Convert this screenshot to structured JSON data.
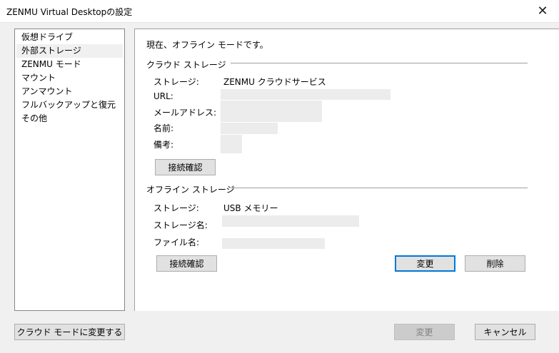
{
  "window": {
    "title": "ZENMU Virtual Desktopの設定"
  },
  "icons": {
    "close": "close-icon"
  },
  "sidebar": {
    "items": [
      {
        "label": "仮想ドライブ",
        "selected": false
      },
      {
        "label": "外部ストレージ",
        "selected": true
      },
      {
        "label": "ZENMU モード",
        "selected": false
      },
      {
        "label": "マウント",
        "selected": false
      },
      {
        "label": "アンマウント",
        "selected": false
      },
      {
        "label": "フルバックアップと復元",
        "selected": false
      },
      {
        "label": "その他",
        "selected": false
      }
    ]
  },
  "main": {
    "status_text": "現在、オフライン モードです。",
    "cloud": {
      "heading": "クラウド ストレージ",
      "storage_label": "ストレージ:",
      "storage_value": "ZENMU クラウドサービス",
      "url_label": "URL:",
      "email_label": "メールアドレス:",
      "name_label": "名前:",
      "note_label": "備考:",
      "check_button": "接続確認"
    },
    "offline": {
      "heading": "オフライン ストレージ",
      "storage_label": "ストレージ:",
      "storage_value": "USB メモリー",
      "storage_name_label": "ストレージ名:",
      "file_name_label": "ファイル名:",
      "check_button": "接続確認",
      "change_button": "変更",
      "delete_button": "削除"
    }
  },
  "footer": {
    "cloud_mode_button": "クラウド モードに変更する",
    "change_button": "変更",
    "cancel_button": "キャンセル"
  },
  "colors": {
    "accent": "#0078d7",
    "background": "#f0f0f0"
  }
}
